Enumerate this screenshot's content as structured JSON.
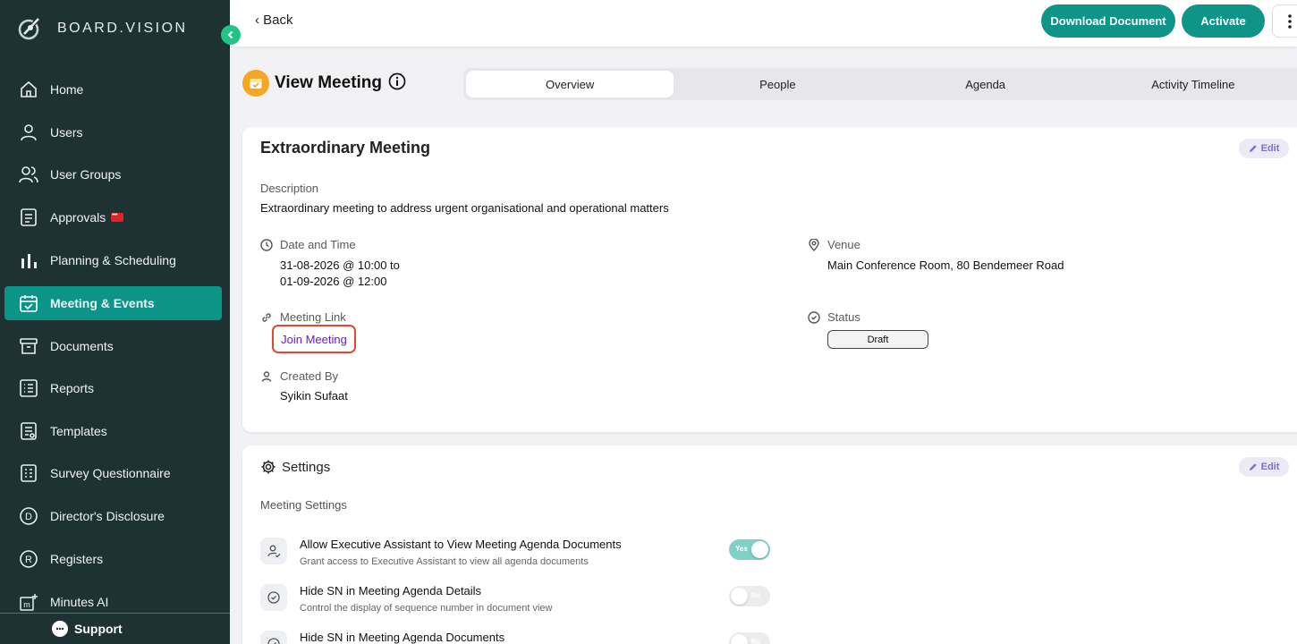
{
  "brand": {
    "name": "BOARD.VISION"
  },
  "sidebar": {
    "items": [
      {
        "label": "Home",
        "icon": "home-icon"
      },
      {
        "label": "Users",
        "icon": "user-icon"
      },
      {
        "label": "User Groups",
        "icon": "users-icon"
      },
      {
        "label": "Approvals",
        "icon": "approvals-icon"
      },
      {
        "label": "Planning & Scheduling",
        "icon": "bar-chart-icon"
      },
      {
        "label": "Meeting & Events",
        "icon": "calendar-check-icon"
      },
      {
        "label": "Documents",
        "icon": "archive-icon"
      },
      {
        "label": "Reports",
        "icon": "list-icon"
      },
      {
        "label": "Templates",
        "icon": "template-icon"
      },
      {
        "label": "Survey Questionnaire",
        "icon": "survey-icon"
      },
      {
        "label": "Director's Disclosure",
        "icon": "d-circle-icon"
      },
      {
        "label": "Registers",
        "icon": "r-circle-icon"
      },
      {
        "label": "Minutes AI",
        "icon": "minutes-ai-icon"
      }
    ],
    "support_label": "Support",
    "accent": "#0d9488"
  },
  "topbar": {
    "back_label": "Back",
    "download_label": "Download Document",
    "activate_label": "Activate"
  },
  "page": {
    "title": "View Meeting",
    "tabs": [
      {
        "label": "Overview",
        "active": true
      },
      {
        "label": "People"
      },
      {
        "label": "Agenda"
      },
      {
        "label": "Activity Timeline"
      }
    ]
  },
  "overview": {
    "meeting_title": "Extraordinary Meeting",
    "edit_label": "Edit",
    "description_label": "Description",
    "description": "Extraordinary meeting to address urgent organisational and operational matters",
    "datetime_label": "Date and Time",
    "datetime_line1": "31-08-2026 @ 10:00 to",
    "datetime_line2": "01-09-2026 @ 12:00",
    "venue_label": "Venue",
    "venue": "Main Conference Room, 80 Bendemeer Road",
    "link_label": "Meeting Link",
    "link_text": "Join Meeting",
    "status_label": "Status",
    "status": "Draft",
    "created_by_label": "Created By",
    "created_by": "Syikin Sufaat"
  },
  "settings": {
    "title": "Settings",
    "edit_label": "Edit",
    "section_label": "Meeting Settings",
    "rows": [
      {
        "title": "Allow Executive Assistant to View Meeting Agenda Documents",
        "subtitle": "Grant access to Executive Assistant to view all agenda documents",
        "toggle_label": "Yes",
        "on": true
      },
      {
        "title": "Hide SN in Meeting Agenda Details",
        "subtitle": "Control the display of sequence number in document view",
        "toggle_label": "No",
        "on": false
      },
      {
        "title": "Hide SN in Meeting Agenda Documents",
        "subtitle": "",
        "toggle_label": "No",
        "on": false
      }
    ]
  }
}
